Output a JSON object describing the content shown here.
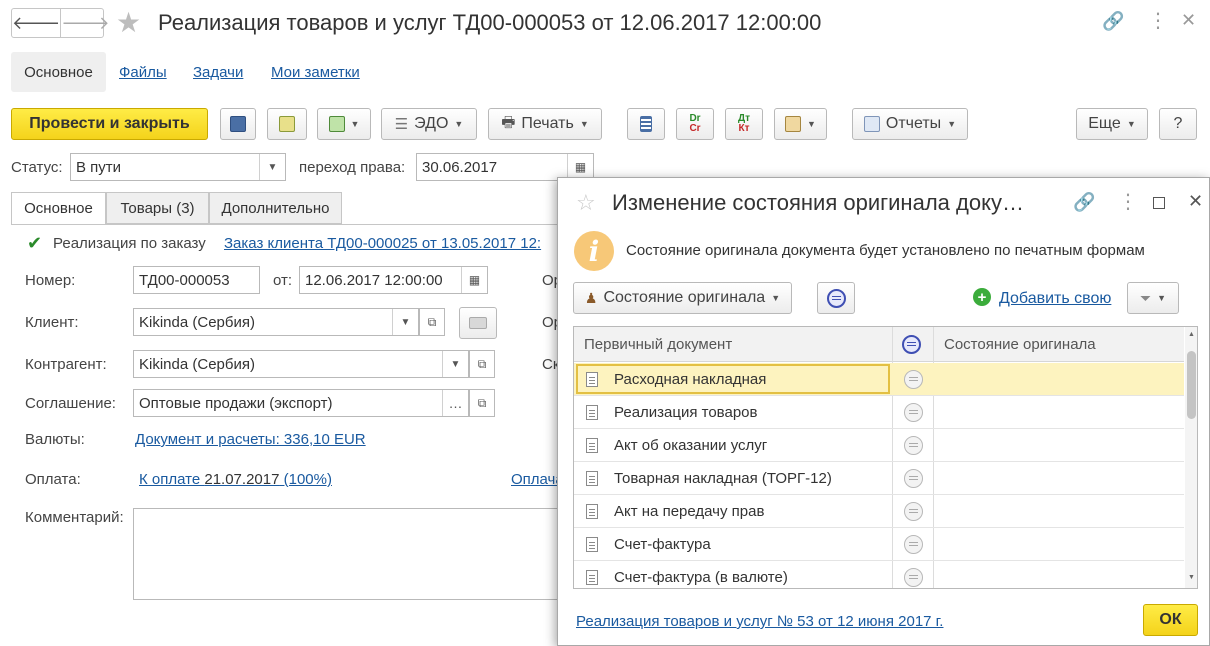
{
  "window": {
    "title": "Реализация товаров и услуг ТД00-000053 от 12.06.2017 12:00:00"
  },
  "sections": [
    "Основное",
    "Файлы",
    "Задачи",
    "Мои заметки"
  ],
  "toolbar": {
    "post_close": "Провести и закрыть",
    "edo": "ЭДО",
    "print": "Печать",
    "reports": "Отчеты",
    "more": "Еще",
    "help": "?",
    "dr_cr_top": "Dr",
    "dr_cr_bottom": "Cr",
    "dt_kt_top": "Дт",
    "dt_kt_bottom": "Кт"
  },
  "status": {
    "label": "Статус:",
    "value": "В пути",
    "transfer_label": "переход права:",
    "transfer_date": "30.06.2017"
  },
  "tabs": [
    "Основное",
    "Товары (3)",
    "Дополнительно"
  ],
  "form": {
    "by_order_label": "Реализация по заказу",
    "order_link": "Заказ клиента ТД00-000025 от 13.05.2017 12:",
    "number_label": "Номер:",
    "number": "ТД00-000053",
    "from_label": "от:",
    "date": "12.06.2017 12:00:00",
    "client_label": "Клиент:",
    "client": "Kikinda (Сербия)",
    "counterparty_label": "Контрагент:",
    "counterparty": "Kikinda (Сербия)",
    "agreement_label": "Соглашение:",
    "agreement": "Оптовые продажи (экспорт)",
    "currency_label": "Валюты:",
    "currency_link": "Документ и расчеты: 336,10 EUR",
    "payment_label": "Оплата:",
    "payment_link_prefix": "К оплате ",
    "payment_date": "21.07.2017",
    "payment_link_suffix": " (100%)",
    "payment_right_link": "Оплача",
    "comment_label": "Комментарий:",
    "cut_label_1": "Ор",
    "cut_label_2": "Ор",
    "cut_label_3": "Ск"
  },
  "dialog": {
    "title": "Изменение состояния оригинала доку…",
    "info": "Состояние оригинала документа будет установлено по печатным формам",
    "state_button": "Состояние оригинала",
    "add_link": "Добавить свою",
    "columns": [
      "Первичный документ",
      "Состояние оригинала"
    ],
    "rows": [
      "Расходная накладная",
      "Реализация товаров",
      "Акт об оказании услуг",
      "Товарная накладная (ТОРГ-12)",
      "Акт на передачу прав",
      "Счет-фактура",
      "Счет-фактура (в валюте)"
    ],
    "footer_link": "Реализация товаров и услуг № 53 от 12 июня 2017 г.",
    "ok": "ОК"
  }
}
